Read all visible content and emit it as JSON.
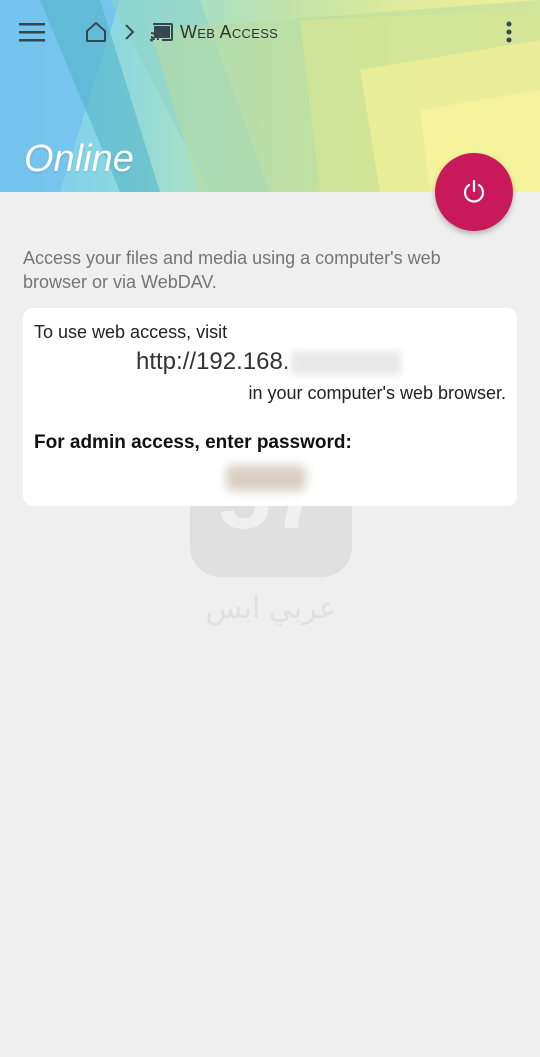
{
  "toolbar": {
    "menu_icon": "hamburger-icon",
    "home_icon": "home-icon",
    "separator_icon": "chevron-right-icon",
    "breadcrumb_icon": "cast-icon",
    "breadcrumb_label": "Web Access",
    "overflow_icon": "more-vert-icon"
  },
  "header": {
    "status_title": "Online"
  },
  "fab": {
    "icon": "power-icon",
    "color": "#c81a5a"
  },
  "main": {
    "description": "Access your files and media using a computer's web browser or via WebDAV."
  },
  "card": {
    "visit_text": "To use web access, visit",
    "url_visible": "http://192.168.",
    "browser_text": "in your computer's web browser.",
    "admin_label": "For admin access, enter password:"
  },
  "watermark": {
    "number": "57",
    "text": "عربي ابس"
  }
}
